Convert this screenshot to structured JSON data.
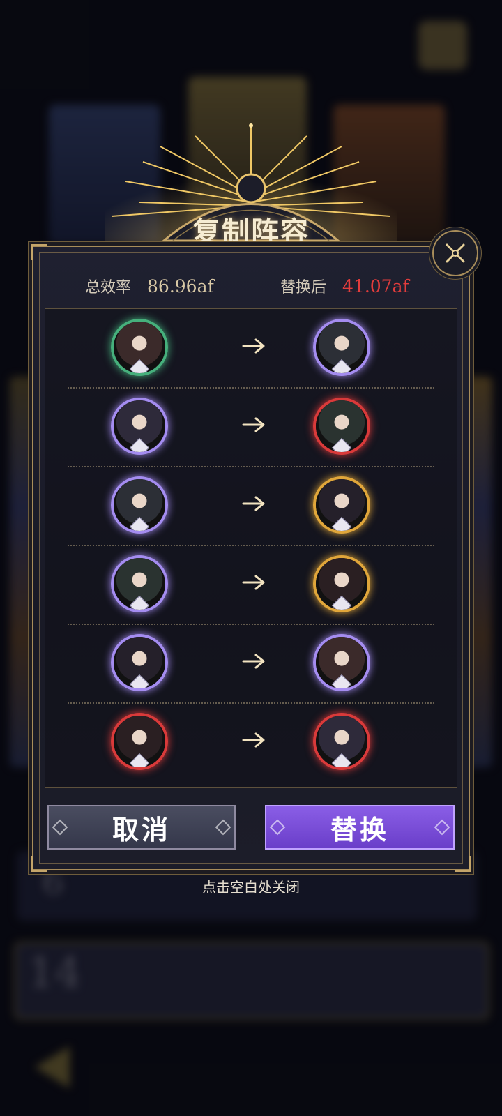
{
  "modal": {
    "title": "复制阵容",
    "stats": {
      "total_label": "总效率",
      "total_value": "86.96af",
      "after_label": "替换后",
      "after_value": "41.07af"
    },
    "colors": {
      "total_value_color": "#d9c9a6",
      "after_value_color": "#e23c3c"
    },
    "rows": [
      {
        "from_icon": "character-portrait-icon",
        "to_icon": "character-portrait-icon",
        "from_ring": "#46b07c",
        "to_ring": "#a48cf0"
      },
      {
        "from_icon": "character-portrait-icon",
        "to_icon": "character-portrait-icon",
        "from_ring": "#a48cf0",
        "to_ring": "#d93a3a"
      },
      {
        "from_icon": "character-portrait-icon",
        "to_icon": "character-portrait-icon",
        "from_ring": "#a48cf0",
        "to_ring": "#e0a63a"
      },
      {
        "from_icon": "character-portrait-icon",
        "to_icon": "character-portrait-icon",
        "from_ring": "#a48cf0",
        "to_ring": "#e0a63a"
      },
      {
        "from_icon": "character-portrait-icon",
        "to_icon": "character-portrait-icon",
        "from_ring": "#a48cf0",
        "to_ring": "#a48cf0"
      },
      {
        "from_icon": "character-portrait-icon",
        "to_icon": "character-portrait-icon",
        "from_ring": "#d93a3a",
        "to_ring": "#d93a3a"
      }
    ],
    "buttons": {
      "cancel_label": "取消",
      "replace_label": "替换"
    },
    "close_hint": "点击空白处关闭"
  },
  "background": {
    "rank_left": "6",
    "rank_bottom": "14"
  }
}
